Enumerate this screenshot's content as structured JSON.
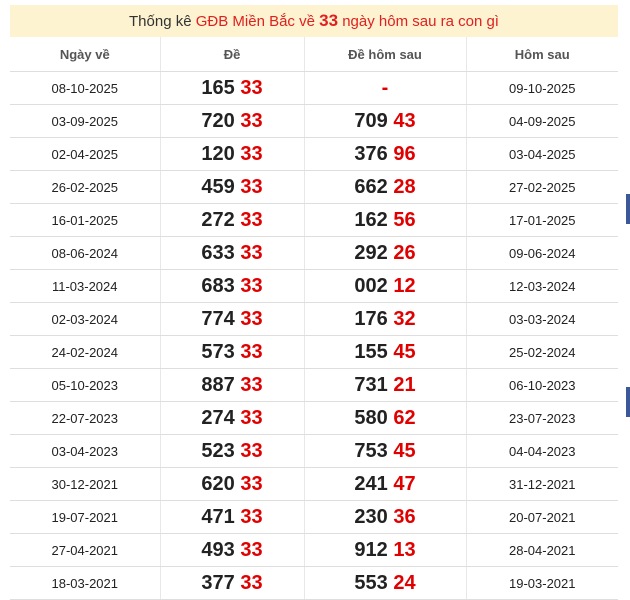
{
  "title": {
    "prefix": "Thống kê",
    "highlight_1": "GĐB Miền Bắc về",
    "number": "33",
    "highlight_2": "ngày hôm sau ra con gì"
  },
  "headers": [
    "Ngày về",
    "Đề",
    "Đề hôm sau",
    "Hôm sau"
  ],
  "rows": [
    {
      "date": "08-10-2025",
      "de_prefix": "165",
      "de_suffix": "33",
      "next_prefix": "",
      "next_suffix": "-",
      "next_date": "09-10-2025"
    },
    {
      "date": "03-09-2025",
      "de_prefix": "720",
      "de_suffix": "33",
      "next_prefix": "709",
      "next_suffix": "43",
      "next_date": "04-09-2025"
    },
    {
      "date": "02-04-2025",
      "de_prefix": "120",
      "de_suffix": "33",
      "next_prefix": "376",
      "next_suffix": "96",
      "next_date": "03-04-2025"
    },
    {
      "date": "26-02-2025",
      "de_prefix": "459",
      "de_suffix": "33",
      "next_prefix": "662",
      "next_suffix": "28",
      "next_date": "27-02-2025"
    },
    {
      "date": "16-01-2025",
      "de_prefix": "272",
      "de_suffix": "33",
      "next_prefix": "162",
      "next_suffix": "56",
      "next_date": "17-01-2025"
    },
    {
      "date": "08-06-2024",
      "de_prefix": "633",
      "de_suffix": "33",
      "next_prefix": "292",
      "next_suffix": "26",
      "next_date": "09-06-2024"
    },
    {
      "date": "11-03-2024",
      "de_prefix": "683",
      "de_suffix": "33",
      "next_prefix": "002",
      "next_suffix": "12",
      "next_date": "12-03-2024"
    },
    {
      "date": "02-03-2024",
      "de_prefix": "774",
      "de_suffix": "33",
      "next_prefix": "176",
      "next_suffix": "32",
      "next_date": "03-03-2024"
    },
    {
      "date": "24-02-2024",
      "de_prefix": "573",
      "de_suffix": "33",
      "next_prefix": "155",
      "next_suffix": "45",
      "next_date": "25-02-2024"
    },
    {
      "date": "05-10-2023",
      "de_prefix": "887",
      "de_suffix": "33",
      "next_prefix": "731",
      "next_suffix": "21",
      "next_date": "06-10-2023"
    },
    {
      "date": "22-07-2023",
      "de_prefix": "274",
      "de_suffix": "33",
      "next_prefix": "580",
      "next_suffix": "62",
      "next_date": "23-07-2023"
    },
    {
      "date": "03-04-2023",
      "de_prefix": "523",
      "de_suffix": "33",
      "next_prefix": "753",
      "next_suffix": "45",
      "next_date": "04-04-2023"
    },
    {
      "date": "30-12-2021",
      "de_prefix": "620",
      "de_suffix": "33",
      "next_prefix": "241",
      "next_suffix": "47",
      "next_date": "31-12-2021"
    },
    {
      "date": "19-07-2021",
      "de_prefix": "471",
      "de_suffix": "33",
      "next_prefix": "230",
      "next_suffix": "36",
      "next_date": "20-07-2021"
    },
    {
      "date": "27-04-2021",
      "de_prefix": "493",
      "de_suffix": "33",
      "next_prefix": "912",
      "next_suffix": "13",
      "next_date": "28-04-2021"
    },
    {
      "date": "18-03-2021",
      "de_prefix": "377",
      "de_suffix": "33",
      "next_prefix": "553",
      "next_suffix": "24",
      "next_date": "19-03-2021"
    }
  ]
}
